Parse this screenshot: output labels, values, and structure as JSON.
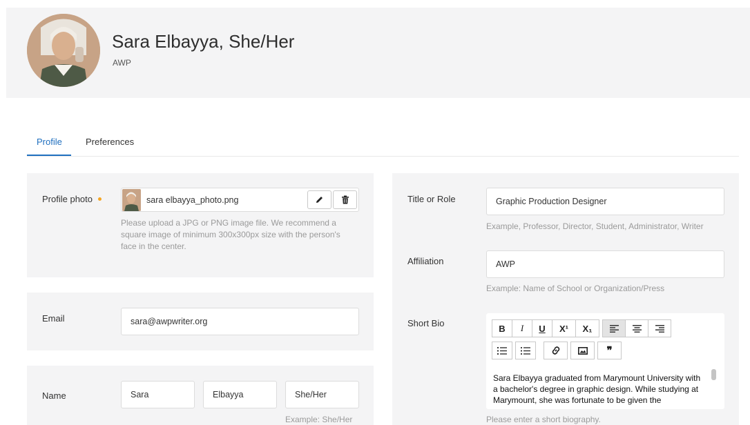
{
  "header": {
    "name": "Sara Elbayya, She/Her",
    "organization": "AWP"
  },
  "tabs": [
    {
      "label": "Profile",
      "active": true
    },
    {
      "label": "Preferences",
      "active": false
    }
  ],
  "profile_photo": {
    "label": "Profile photo",
    "filename": "sara elbayya_photo.png",
    "hint": "Please upload a JPG or PNG image file. We recommend a square image of minimum 300x300px size with the person's face in the center."
  },
  "email": {
    "label": "Email",
    "value": "sara@awpwriter.org"
  },
  "name_section": {
    "label": "Name",
    "first": "Sara",
    "last": "Elbayya",
    "pronouns": "She/Her",
    "hint": "Example: She/Her"
  },
  "title_role": {
    "label": "Title or Role",
    "value": "Graphic Production Designer",
    "hint": "Example, Professor, Director, Student, Administrator, Writer"
  },
  "affiliation": {
    "label": "Affiliation",
    "value": "AWP",
    "hint": "Example: Name of School or Organization/Press"
  },
  "short_bio": {
    "label": "Short Bio",
    "text": "Sara Elbayya graduated from Marymount University with a bachelor's degree in graphic design. While studying at Marymount, she was fortunate to be given the",
    "hint": "Please enter a short biography.",
    "toolbar": {
      "bold": "B",
      "italic": "I",
      "underline": "U",
      "superscript": "X¹",
      "subscript": "X₁",
      "blockquote": "❞"
    }
  },
  "colors": {
    "accent": "#1f6fbf",
    "required_dot": "#f5a623",
    "panel_bg": "#f4f4f5"
  }
}
